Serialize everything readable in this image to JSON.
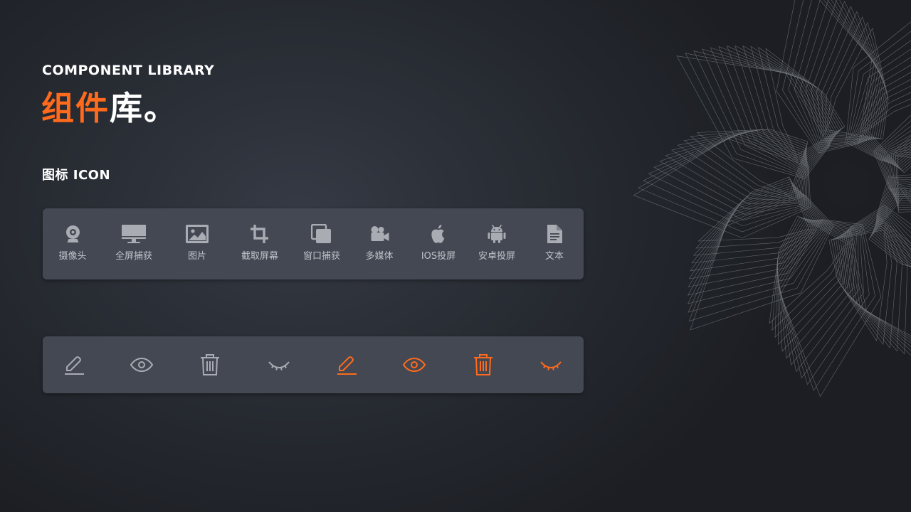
{
  "header": {
    "subtitle_en": "COMPONENT LIBRARY",
    "title_accent": "组件",
    "title_rest": "库。"
  },
  "section": {
    "title": "图标 ICON"
  },
  "icon_panel": {
    "items": [
      {
        "icon": "webcam-icon",
        "label": "摄像头"
      },
      {
        "icon": "monitor-icon",
        "label": "全屏捕获"
      },
      {
        "icon": "image-icon",
        "label": "图片"
      },
      {
        "icon": "crop-icon",
        "label": "截取屏幕"
      },
      {
        "icon": "window-icon",
        "label": "窗口捕获"
      },
      {
        "icon": "video-camera-icon",
        "label": "多媒体"
      },
      {
        "icon": "apple-icon",
        "label": "IOS投屏"
      },
      {
        "icon": "android-icon",
        "label": "安卓投屏"
      },
      {
        "icon": "document-icon",
        "label": "文本"
      }
    ]
  },
  "action_panel": {
    "items": [
      {
        "icon": "edit-icon",
        "state": "default"
      },
      {
        "icon": "eye-icon",
        "state": "default"
      },
      {
        "icon": "trash-icon",
        "state": "default"
      },
      {
        "icon": "eye-closed-icon",
        "state": "default"
      },
      {
        "icon": "edit-icon",
        "state": "active"
      },
      {
        "icon": "eye-icon",
        "state": "active"
      },
      {
        "icon": "trash-icon",
        "state": "active"
      },
      {
        "icon": "eye-closed-icon",
        "state": "active"
      }
    ]
  },
  "colors": {
    "accent": "#ff6a1c",
    "icon_default": "#a9acb2",
    "panel_bg": "#434852",
    "background": "#262a31"
  }
}
